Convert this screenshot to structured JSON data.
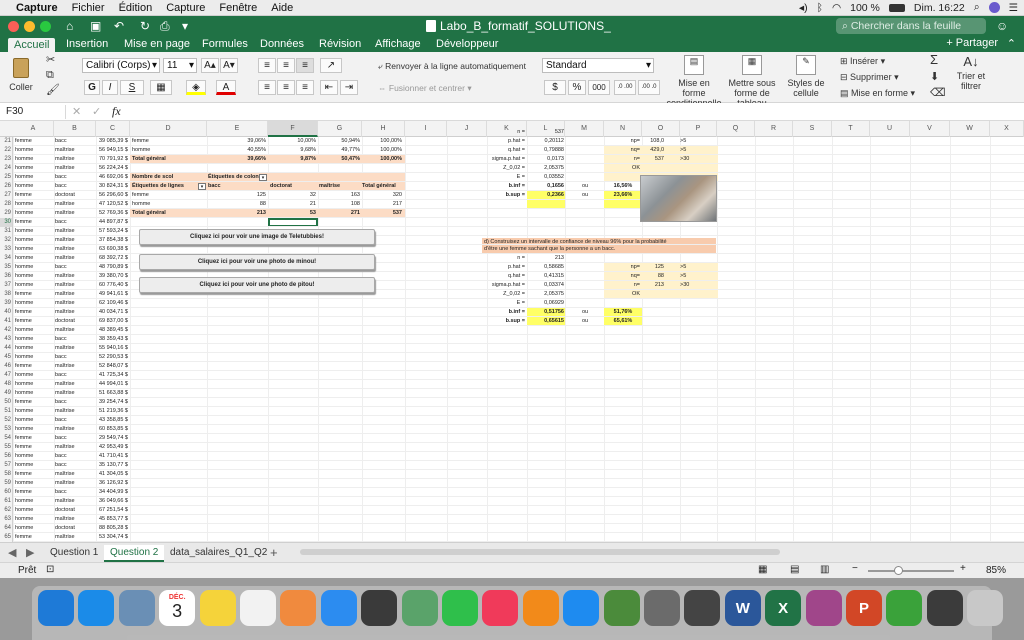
{
  "menubar": {
    "app": "Capture",
    "items": [
      "Fichier",
      "Édition",
      "Capture",
      "Fenêtre",
      "Aide"
    ],
    "battery": "100 %",
    "clock": "Dim. 16:22"
  },
  "window": {
    "title": "Labo_B_formatif_SOLUTIONS_",
    "search_placeholder": "Chercher dans la feuille"
  },
  "ribbon": {
    "tabs": [
      "Accueil",
      "Insertion",
      "Mise en page",
      "Formules",
      "Données",
      "Révision",
      "Affichage",
      "Développeur"
    ],
    "active_tab": "Accueil",
    "share": "Partager",
    "paste": "Coller",
    "font": "Calibri (Corps)",
    "font_size": "11",
    "bold": "G",
    "italic": "I",
    "underline": "S",
    "wrap": "Renvoyer à la ligne automatiquement",
    "merge": "Fusionner et centrer",
    "number_format": "Standard",
    "currency": "$",
    "percent": "%",
    "thousands": "000",
    "dec_inc": ".0 .00",
    "dec_dec": ".00 .0",
    "cond_format": [
      "Mise en forme",
      "conditionnelle"
    ],
    "table_format": [
      "Mettre sous",
      "forme de tableau"
    ],
    "cell_styles": [
      "Styles de",
      "cellule"
    ],
    "insert": "Insérer",
    "delete": "Supprimer",
    "format": "Mise en forme",
    "sort": [
      "Trier et",
      "filtrer"
    ]
  },
  "formula_bar": {
    "cell": "F30",
    "fx": "fx",
    "value": ""
  },
  "columns": [
    "A",
    "B",
    "C",
    "D",
    "E",
    "F",
    "G",
    "H",
    "I",
    "J",
    "K",
    "L",
    "M",
    "N",
    "O",
    "P",
    "Q",
    "R",
    "S",
    "T",
    "U",
    "V",
    "W",
    "X"
  ],
  "rows": [
    [
      "21",
      "femme",
      "bacc",
      "39 085,39 $"
    ],
    [
      "22",
      "homme",
      "maîtrise",
      "56 949,15 $"
    ],
    [
      "23",
      "homme",
      "maîtrise",
      "70 791,92 $"
    ],
    [
      "24",
      "homme",
      "maîtrise",
      "56 224,24 $"
    ],
    [
      "25",
      "homme",
      "bacc",
      "46 692,06 $"
    ],
    [
      "26",
      "homme",
      "bacc",
      "30 824,31 $"
    ],
    [
      "27",
      "femme",
      "doctorat",
      "56 296,60 $"
    ],
    [
      "28",
      "homme",
      "maîtrise",
      "47 120,52 $"
    ],
    [
      "29",
      "homme",
      "maîtrise",
      "52 769,36 $"
    ],
    [
      "30",
      "femme",
      "bacc",
      "44 897,87 $"
    ],
    [
      "31",
      "homme",
      "maîtrise",
      "57 593,24 $"
    ],
    [
      "32",
      "homme",
      "maîtrise",
      "37 854,38 $"
    ],
    [
      "33",
      "homme",
      "maîtrise",
      "63 690,38 $"
    ],
    [
      "34",
      "homme",
      "maîtrise",
      "68 392,72 $"
    ],
    [
      "35",
      "homme",
      "bacc",
      "48 790,89 $"
    ],
    [
      "36",
      "homme",
      "maîtrise",
      "39 380,70 $"
    ],
    [
      "37",
      "homme",
      "maîtrise",
      "60 776,40 $"
    ],
    [
      "38",
      "femme",
      "maîtrise",
      "49 941,61 $"
    ],
    [
      "39",
      "homme",
      "maîtrise",
      "62 109,46 $"
    ],
    [
      "40",
      "femme",
      "maîtrise",
      "40 034,71 $"
    ],
    [
      "41",
      "femme",
      "doctorat",
      "69 837,00 $"
    ],
    [
      "42",
      "homme",
      "maîtrise",
      "48 389,45 $"
    ],
    [
      "43",
      "homme",
      "bacc",
      "38 359,43 $"
    ],
    [
      "44",
      "homme",
      "maîtrise",
      "55 940,16 $"
    ],
    [
      "45",
      "homme",
      "bacc",
      "52 290,53 $"
    ],
    [
      "46",
      "femme",
      "maîtrise",
      "52 848,07 $"
    ],
    [
      "47",
      "homme",
      "bacc",
      "41 725,34 $"
    ],
    [
      "48",
      "homme",
      "maîtrise",
      "44 994,01 $"
    ],
    [
      "49",
      "homme",
      "maîtrise",
      "51 663,88 $"
    ],
    [
      "50",
      "femme",
      "bacc",
      "39 254,74 $"
    ],
    [
      "51",
      "homme",
      "maîtrise",
      "51 219,36 $"
    ],
    [
      "52",
      "homme",
      "bacc",
      "43 358,85 $"
    ],
    [
      "53",
      "homme",
      "maîtrise",
      "60 853,85 $"
    ],
    [
      "54",
      "femme",
      "bacc",
      "29 549,74 $"
    ],
    [
      "55",
      "femme",
      "maîtrise",
      "42 953,49 $"
    ],
    [
      "56",
      "homme",
      "bacc",
      "41 710,41 $"
    ],
    [
      "57",
      "homme",
      "bacc",
      "35 130,77 $"
    ],
    [
      "58",
      "femme",
      "maîtrise",
      "41 304,05 $"
    ],
    [
      "59",
      "homme",
      "maîtrise",
      "36 126,92 $"
    ],
    [
      "60",
      "femme",
      "bacc",
      "34 404,99 $"
    ],
    [
      "61",
      "homme",
      "maîtrise",
      "36 049,66 $"
    ],
    [
      "62",
      "homme",
      "doctorat",
      "67 251,54 $"
    ],
    [
      "63",
      "homme",
      "maîtrise",
      "45 853,77 $"
    ],
    [
      "64",
      "homme",
      "doctorat",
      "88 805,28 $"
    ],
    [
      "65",
      "femme",
      "maîtrise",
      "53 304,74 $"
    ]
  ],
  "pct_table": [
    [
      "femme",
      "39,06%",
      "10,00%",
      "50,94%",
      "100,00%"
    ],
    [
      "homme",
      "40,55%",
      "9,68%",
      "49,77%",
      "100,00%"
    ],
    [
      "Total général",
      "39,66%",
      "9,87%",
      "50,47%",
      "100,00%"
    ]
  ],
  "pivot": {
    "title": "Nombre de scol",
    "col_label": "Étiquettes de colon",
    "row_label": "Étiquettes de lignes",
    "cols": [
      "bacc",
      "doctorat",
      "maîtrise",
      "Total général"
    ],
    "rows": [
      [
        "femme",
        "125",
        "32",
        "163",
        "320"
      ],
      [
        "homme",
        "88",
        "21",
        "108",
        "217"
      ],
      [
        "Total général",
        "213",
        "53",
        "271",
        "537"
      ]
    ]
  },
  "macros": [
    "Cliquez ici pour voir une image de Teletubbies!",
    "Cliquez ici pour voir une photo de minou!",
    "Cliquez ici pour voir une photo de pitou!"
  ],
  "calc1": {
    "labels": [
      "n =",
      "p.hat =",
      "q.hat =",
      "sigma.p.hat =",
      "Z_0,02 =",
      "E =",
      "b.inf =",
      "b.sup ="
    ],
    "values": [
      "537",
      "0,20112",
      "0,79888",
      "0,0173",
      "2,05375",
      "0,03552",
      "0,1656",
      "0,2366"
    ],
    "ou": [
      "ou",
      "ou"
    ],
    "pcts": [
      "16,56%",
      "23,66%"
    ],
    "check_labels": [
      "np=",
      "nq=",
      "n="
    ],
    "check_vals": [
      "108,0",
      "429,0",
      "537"
    ],
    "check_conds": [
      ">5",
      ">5",
      ">30"
    ],
    "ok": "OK"
  },
  "question_d": {
    "text1": "d) Construisez un intervalle de confiance de niveau 96% pour la probabilité",
    "text2": "d'être une femme sachant que la personne a un bacc."
  },
  "calc2": {
    "labels": [
      "n =",
      "p.hat =",
      "q.hat =",
      "sigma.p.hat =",
      "Z_0,02 =",
      "E =",
      "b.inf =",
      "b.sup ="
    ],
    "values": [
      "213",
      "0,58685",
      "0,41315",
      "0,03374",
      "2,05375",
      "0,06929",
      "0,51756",
      "0,65615"
    ],
    "ou": [
      "ou",
      "ou"
    ],
    "pcts": [
      "51,76%",
      "65,61%"
    ],
    "check_labels": [
      "np=",
      "nq=",
      "n="
    ],
    "check_vals": [
      "125",
      "88",
      "213"
    ],
    "check_conds": [
      ">5",
      ">5",
      ">30"
    ],
    "ok": "OK"
  },
  "sheets": [
    "Question 1",
    "Question 2",
    "data_salaires_Q1_Q2"
  ],
  "active_sheet": "Question 2",
  "status": {
    "ready": "Prêt",
    "zoom": "85%"
  },
  "dock": [
    "Finder",
    "Safari",
    "Aperçu",
    "Calendrier",
    "Notes",
    "Rappels",
    "Photos",
    "Messages",
    "Launchpad",
    "Plans",
    "FaceTime",
    "Musique",
    "Livres",
    "App Store",
    "Minecraft",
    "Préférences",
    "Capture",
    "Word",
    "Excel",
    "Karaoké",
    "PowerPoint",
    "Sims",
    "Téléchargements",
    "Corbeille"
  ],
  "dock_calendar": {
    "month": "DÉC.",
    "day": "3"
  },
  "colors": {
    "excel_green": "#207245",
    "header_fill": "#fcdcc5",
    "yellow": "#ffff66",
    "light_yellow": "#fff2cc",
    "question_fill": "#f8cbad"
  }
}
